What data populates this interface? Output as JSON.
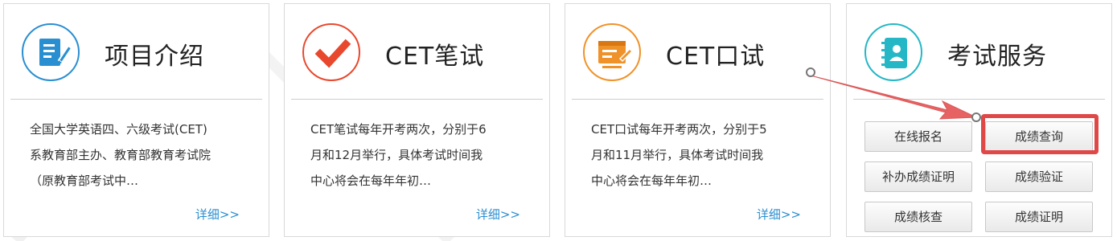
{
  "cards": [
    {
      "title": "项目介绍",
      "icon": "document-edit-icon",
      "lines": [
        "全国大学英语四、六级考试(CET)",
        "系教育部主办、教育部教育考试院",
        "（原教育部考试中…"
      ],
      "more": "详细>>"
    },
    {
      "title": "CET笔试",
      "icon": "checkmark-icon",
      "lines": [
        "CET笔试每年开考两次，分别于6",
        "月和12月举行，具体考试时间我",
        "中心将会在每年年初…"
      ],
      "more": "详细>>"
    },
    {
      "title": "CET口试",
      "icon": "certificate-icon",
      "lines": [
        "CET口试每年开考两次，分别于5",
        "月和11月举行，具体考试时间我",
        "中心将会在每年年初…"
      ],
      "more": "详细>>"
    },
    {
      "title": "考试服务",
      "icon": "address-book-icon",
      "buttons": [
        "在线报名",
        "成绩查询",
        "补办成绩证明",
        "成绩验证",
        "成绩核查",
        "成绩证明"
      ]
    }
  ],
  "colors": {
    "blue_icon": "#2a8fd1",
    "red_icon": "#e8482d",
    "orange_icon": "#f0922a",
    "cyan_icon": "#25b7c6",
    "link": "#2a8fd1",
    "highlight": "#e04848"
  }
}
